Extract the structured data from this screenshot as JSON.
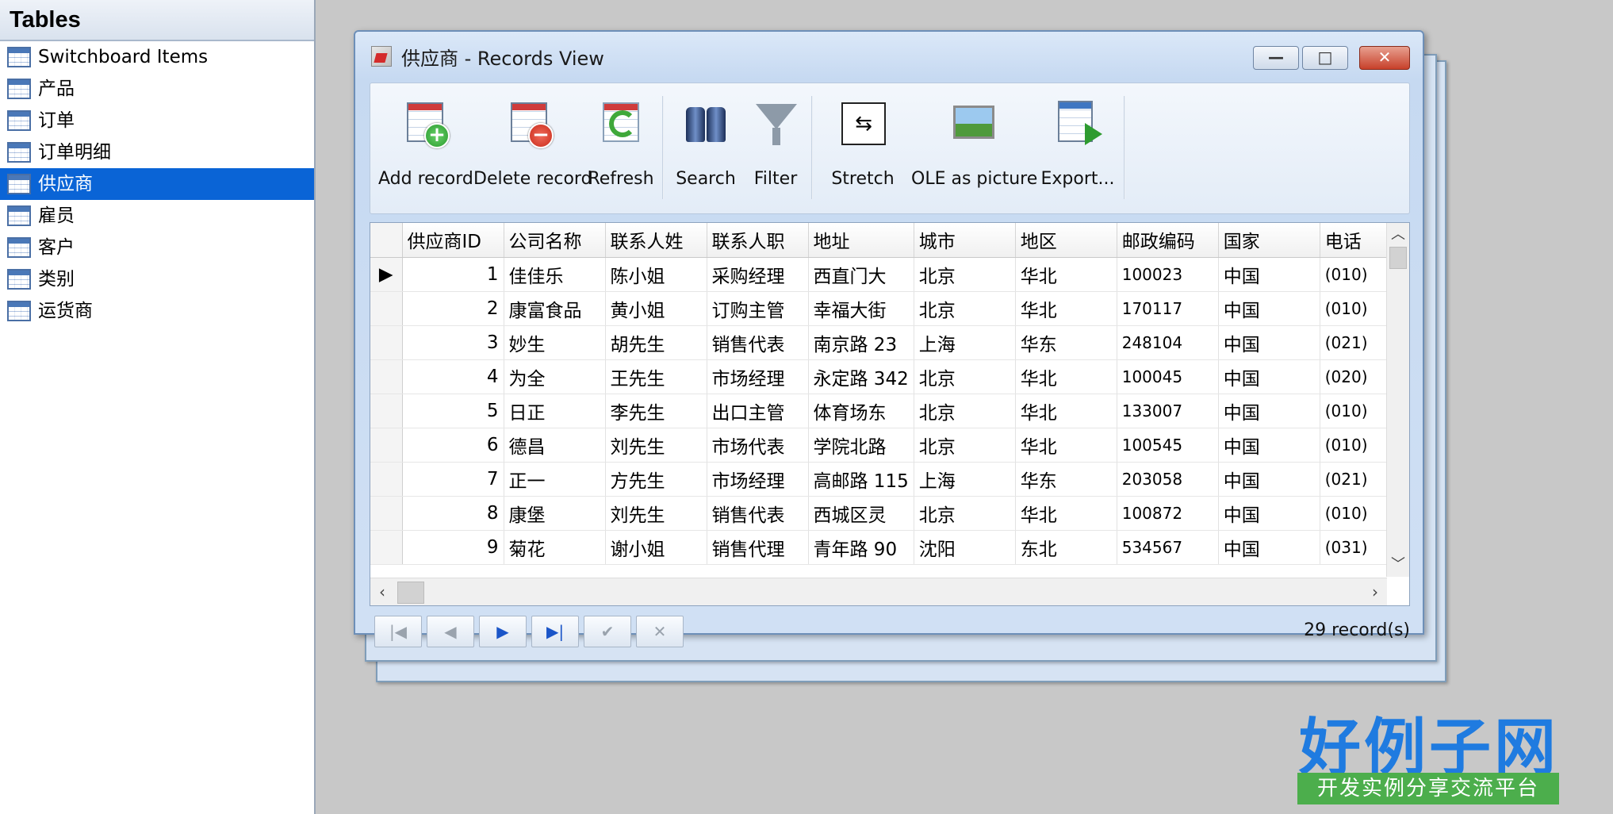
{
  "tables_panel": {
    "title": "Tables",
    "items": [
      {
        "label": "Switchboard Items",
        "selected": false
      },
      {
        "label": "产品",
        "selected": false
      },
      {
        "label": "订单",
        "selected": false
      },
      {
        "label": "订单明细",
        "selected": false
      },
      {
        "label": "供应商",
        "selected": true
      },
      {
        "label": "雇员",
        "selected": false
      },
      {
        "label": "客户",
        "selected": false
      },
      {
        "label": "类别",
        "selected": false
      },
      {
        "label": "运货商",
        "selected": false
      }
    ]
  },
  "window": {
    "title": "供应商 - Records View",
    "controls": {
      "minimize": "—",
      "maximize": "□",
      "close": "✕"
    }
  },
  "toolbar": {
    "add_record": "Add record",
    "delete_record": "Delete record",
    "refresh": "Refresh",
    "search": "Search",
    "filter": "Filter",
    "stretch": "Stretch",
    "ole_as_picture": "OLE as picture",
    "export": "Export...",
    "stretch_glyph": "⇆"
  },
  "grid": {
    "columns": [
      "供应商ID",
      "公司名称",
      "联系人姓",
      "联系人职",
      "地址",
      "城市",
      "地区",
      "邮政编码",
      "国家",
      "电话"
    ],
    "current_row_marker": "▶",
    "rows": [
      [
        "1",
        "佳佳乐",
        "陈小姐",
        "采购经理",
        "西直门大",
        "北京",
        "华北",
        "100023",
        "中国",
        "(010)"
      ],
      [
        "2",
        "康富食品",
        "黄小姐",
        "订购主管",
        "幸福大街",
        "北京",
        "华北",
        "170117",
        "中国",
        "(010)"
      ],
      [
        "3",
        "妙生",
        "胡先生",
        "销售代表",
        "南京路 23",
        "上海",
        "华东",
        "248104",
        "中国",
        "(021)"
      ],
      [
        "4",
        "为全",
        "王先生",
        "市场经理",
        "永定路 342",
        "北京",
        "华北",
        "100045",
        "中国",
        "(020)"
      ],
      [
        "5",
        "日正",
        "李先生",
        "出口主管",
        "体育场东",
        "北京",
        "华北",
        "133007",
        "中国",
        "(010)"
      ],
      [
        "6",
        "德昌",
        "刘先生",
        "市场代表",
        "学院北路",
        "北京",
        "华北",
        "100545",
        "中国",
        "(010)"
      ],
      [
        "7",
        "正一",
        "方先生",
        "市场经理",
        "高邮路 115",
        "上海",
        "华东",
        "203058",
        "中国",
        "(021)"
      ],
      [
        "8",
        "康堡",
        "刘先生",
        "销售代表",
        "西城区灵",
        "北京",
        "华北",
        "100872",
        "中国",
        "(010)"
      ],
      [
        "9",
        "菊花",
        "谢小姐",
        "销售代理",
        "青年路 90",
        "沈阳",
        "东北",
        "534567",
        "中国",
        "(031)"
      ]
    ],
    "scroll": {
      "up": "︿",
      "down": "﹀",
      "left": "‹",
      "right": "›"
    }
  },
  "navigator": {
    "first": "|◀",
    "prior": "◀",
    "next": "▶",
    "last": "▶|",
    "post": "✔",
    "cancel": "✕",
    "record_count": "29 record(s)"
  },
  "watermark": {
    "logo": "好例子网",
    "tagline": "开发实例分享交流平台"
  }
}
